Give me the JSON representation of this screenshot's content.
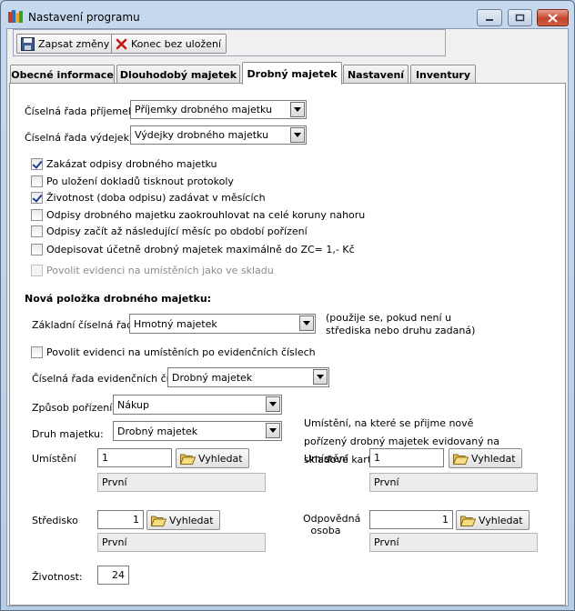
{
  "window": {
    "title": "Nastavení programu"
  },
  "toolbar": {
    "save_label": "Zapsat změny",
    "close_label": "Konec bez uložení"
  },
  "tabs": [
    {
      "label": "Obecné informace"
    },
    {
      "label": "Dlouhodobý majetek"
    },
    {
      "label": "Drobný majetek"
    },
    {
      "label": "Nastavení"
    },
    {
      "label": "Inventury"
    }
  ],
  "series": {
    "receipts_label": "Číselná řada příjemek:",
    "receipts_value": "Příjemky drobného majetku",
    "issues_label": "Číselná řada výdejek:",
    "issues_value": "Výdejky drobného majetku"
  },
  "options": [
    {
      "label": "Zakázat odpisy drobného majetku",
      "checked": true
    },
    {
      "label": "Po uložení dokladů tisknout protokoly",
      "checked": false
    },
    {
      "label": "Životnost (doba odpisu) zadávat v měsících",
      "checked": true
    },
    {
      "label": "Odpisy drobného majetku zaokrouhlovat na celé koruny nahoru",
      "checked": false
    },
    {
      "label": "Odpisy začít až následující měsíc po období pořízení",
      "checked": false
    },
    {
      "label": "Odepisovat účetně drobný majetek maximálně do ZC= 1,- Kč",
      "checked": false
    },
    {
      "label": "Povolit evidenci na umístěních jako ve skladu",
      "checked": false,
      "disabled": true
    }
  ],
  "new_item": {
    "heading": "Nová položka drobného majetku:",
    "basic_series_label": "Základní číselná řada",
    "basic_series_value": "Hmotný majetek",
    "basic_series_note": "(použije se, pokud není u střediska nebo druhu zadaná)",
    "allow_locations_label": "Povolit evidenci na umístěních po evidenčních číslech",
    "allow_locations_checked": false,
    "evidence_series_label": "Číselná řada evidenčních čísel:",
    "evidence_series_value": "Drobný majetek",
    "acquisition_label": "Způsob pořízení:",
    "acquisition_value": "Nákup",
    "kind_label": "Druh majetku:",
    "kind_value": "Drobný majetek",
    "location_label": "Umístění",
    "location_value": "1",
    "location_name": "První",
    "center_label": "Středisko",
    "center_value": "1",
    "center_name": "První",
    "lifetime_label": "Životnost:",
    "lifetime_value": "24",
    "search_label": "Vyhledat"
  },
  "store_card": {
    "note": "Umístění, na které se přijme nově pořízený drobný majetek evidovaný na skladové kartě:",
    "location_label": "Umístění",
    "location_value": "1",
    "location_name": "První",
    "person_label": "Odpovědná osoba",
    "person_value": "1",
    "person_name": "První"
  },
  "icons": {
    "app": "app-icon",
    "save": "floppy-icon",
    "close": "red-x-icon",
    "search": "folder-open-icon",
    "dropdown": "chevron-down-icon"
  }
}
